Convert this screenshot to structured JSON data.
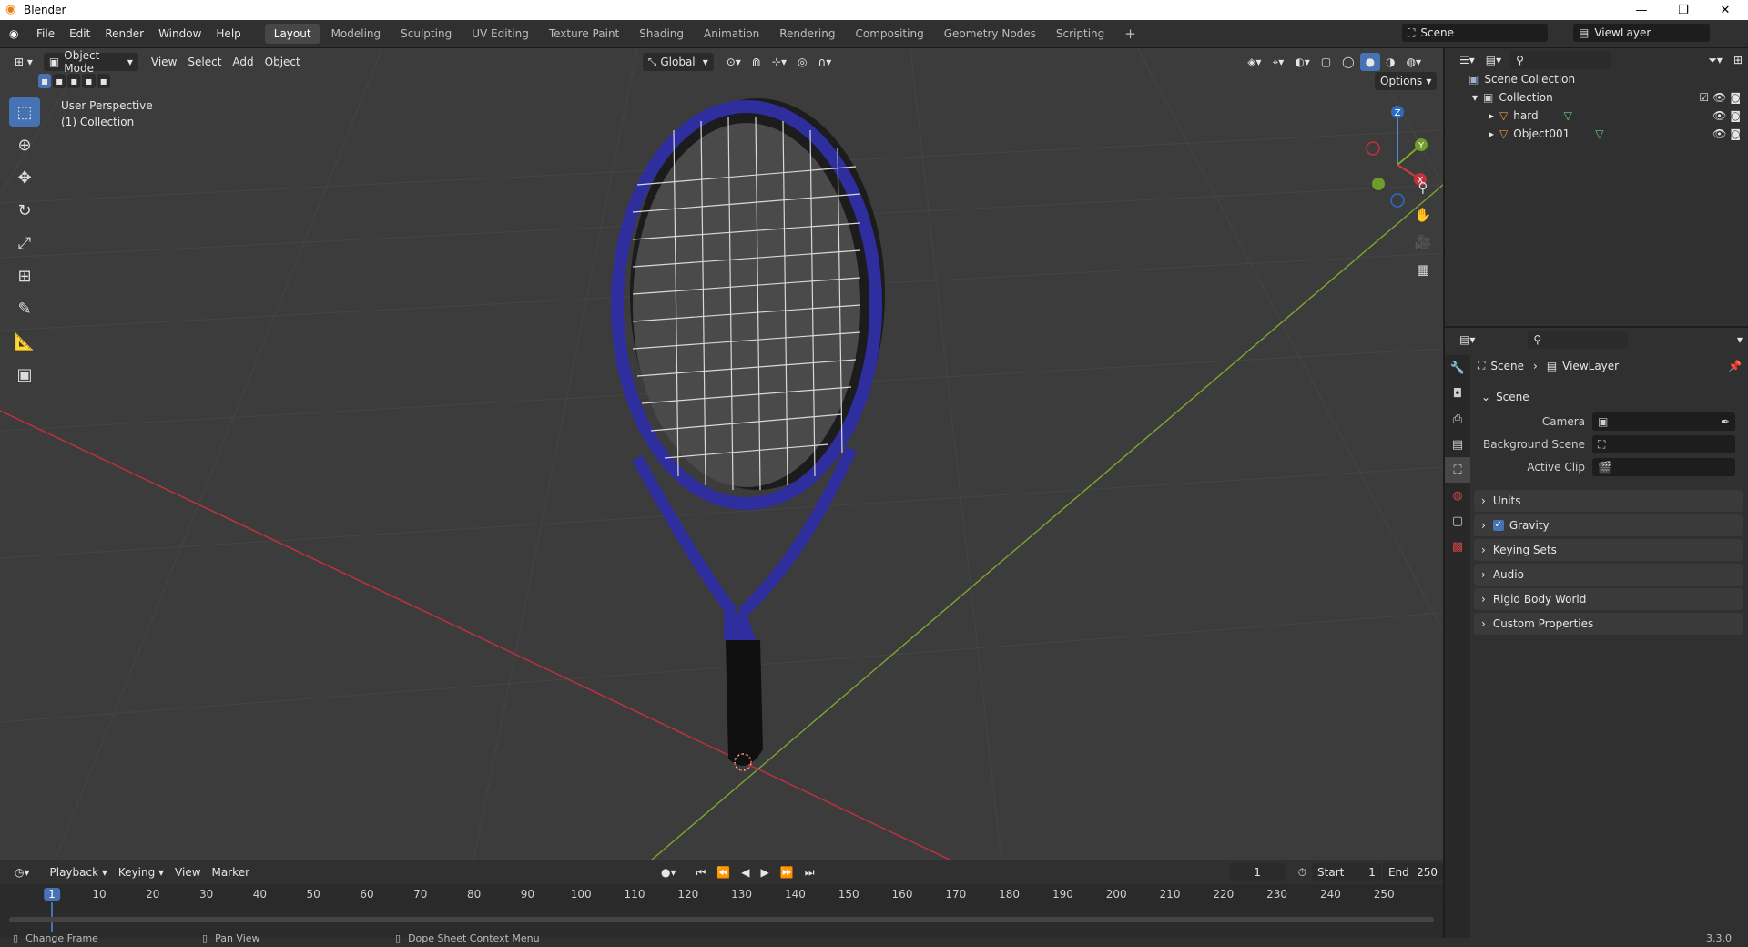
{
  "window": {
    "title": "Blender",
    "version": "3.3.0"
  },
  "menu": [
    "File",
    "Edit",
    "Render",
    "Window",
    "Help"
  ],
  "workspaces": [
    "Layout",
    "Modeling",
    "Sculpting",
    "UV Editing",
    "Texture Paint",
    "Shading",
    "Animation",
    "Rendering",
    "Compositing",
    "Geometry Nodes",
    "Scripting"
  ],
  "active_workspace": "Layout",
  "scene_selector": "Scene",
  "viewlayer_selector": "ViewLayer",
  "viewport": {
    "mode": "Object Mode",
    "menus": [
      "View",
      "Select",
      "Add",
      "Object"
    ],
    "transform_orientation": "Global",
    "options_label": "Options",
    "info_line1": "User Perspective",
    "info_line2": "(1) Collection",
    "gizmo": {
      "x": "X",
      "y": "Y",
      "z": "Z"
    }
  },
  "outliner": {
    "root": "Scene Collection",
    "collection": "Collection",
    "objects": [
      "hard",
      "Object001"
    ]
  },
  "properties": {
    "breadcrumb_scene": "Scene",
    "breadcrumb_viewlayer": "ViewLayer",
    "panel_scene": "Scene",
    "camera_label": "Camera",
    "background_scene_label": "Background Scene",
    "active_clip_label": "Active Clip",
    "panels": [
      "Units",
      "Gravity",
      "Keying Sets",
      "Audio",
      "Rigid Body World",
      "Custom Properties"
    ],
    "gravity_checked": true
  },
  "timeline": {
    "menus": [
      "Playback",
      "Keying",
      "View",
      "Marker"
    ],
    "current_frame": "1",
    "start_label": "Start",
    "start_value": "1",
    "end_label": "End",
    "end_value": "250",
    "ruler_labels": [
      "1",
      "10",
      "20",
      "30",
      "40",
      "50",
      "60",
      "70",
      "80",
      "90",
      "100",
      "110",
      "120",
      "130",
      "140",
      "150",
      "160",
      "170",
      "180",
      "190",
      "200",
      "210",
      "220",
      "230",
      "240",
      "250"
    ]
  },
  "status": {
    "left": "Change Frame",
    "middle": "Pan View",
    "right": "Dope Sheet Context Menu"
  },
  "colors": {
    "accent": "#4772b3",
    "racket": "#2e2e9e",
    "x_axis": "#c4313c",
    "y_axis": "#7aa82e"
  }
}
